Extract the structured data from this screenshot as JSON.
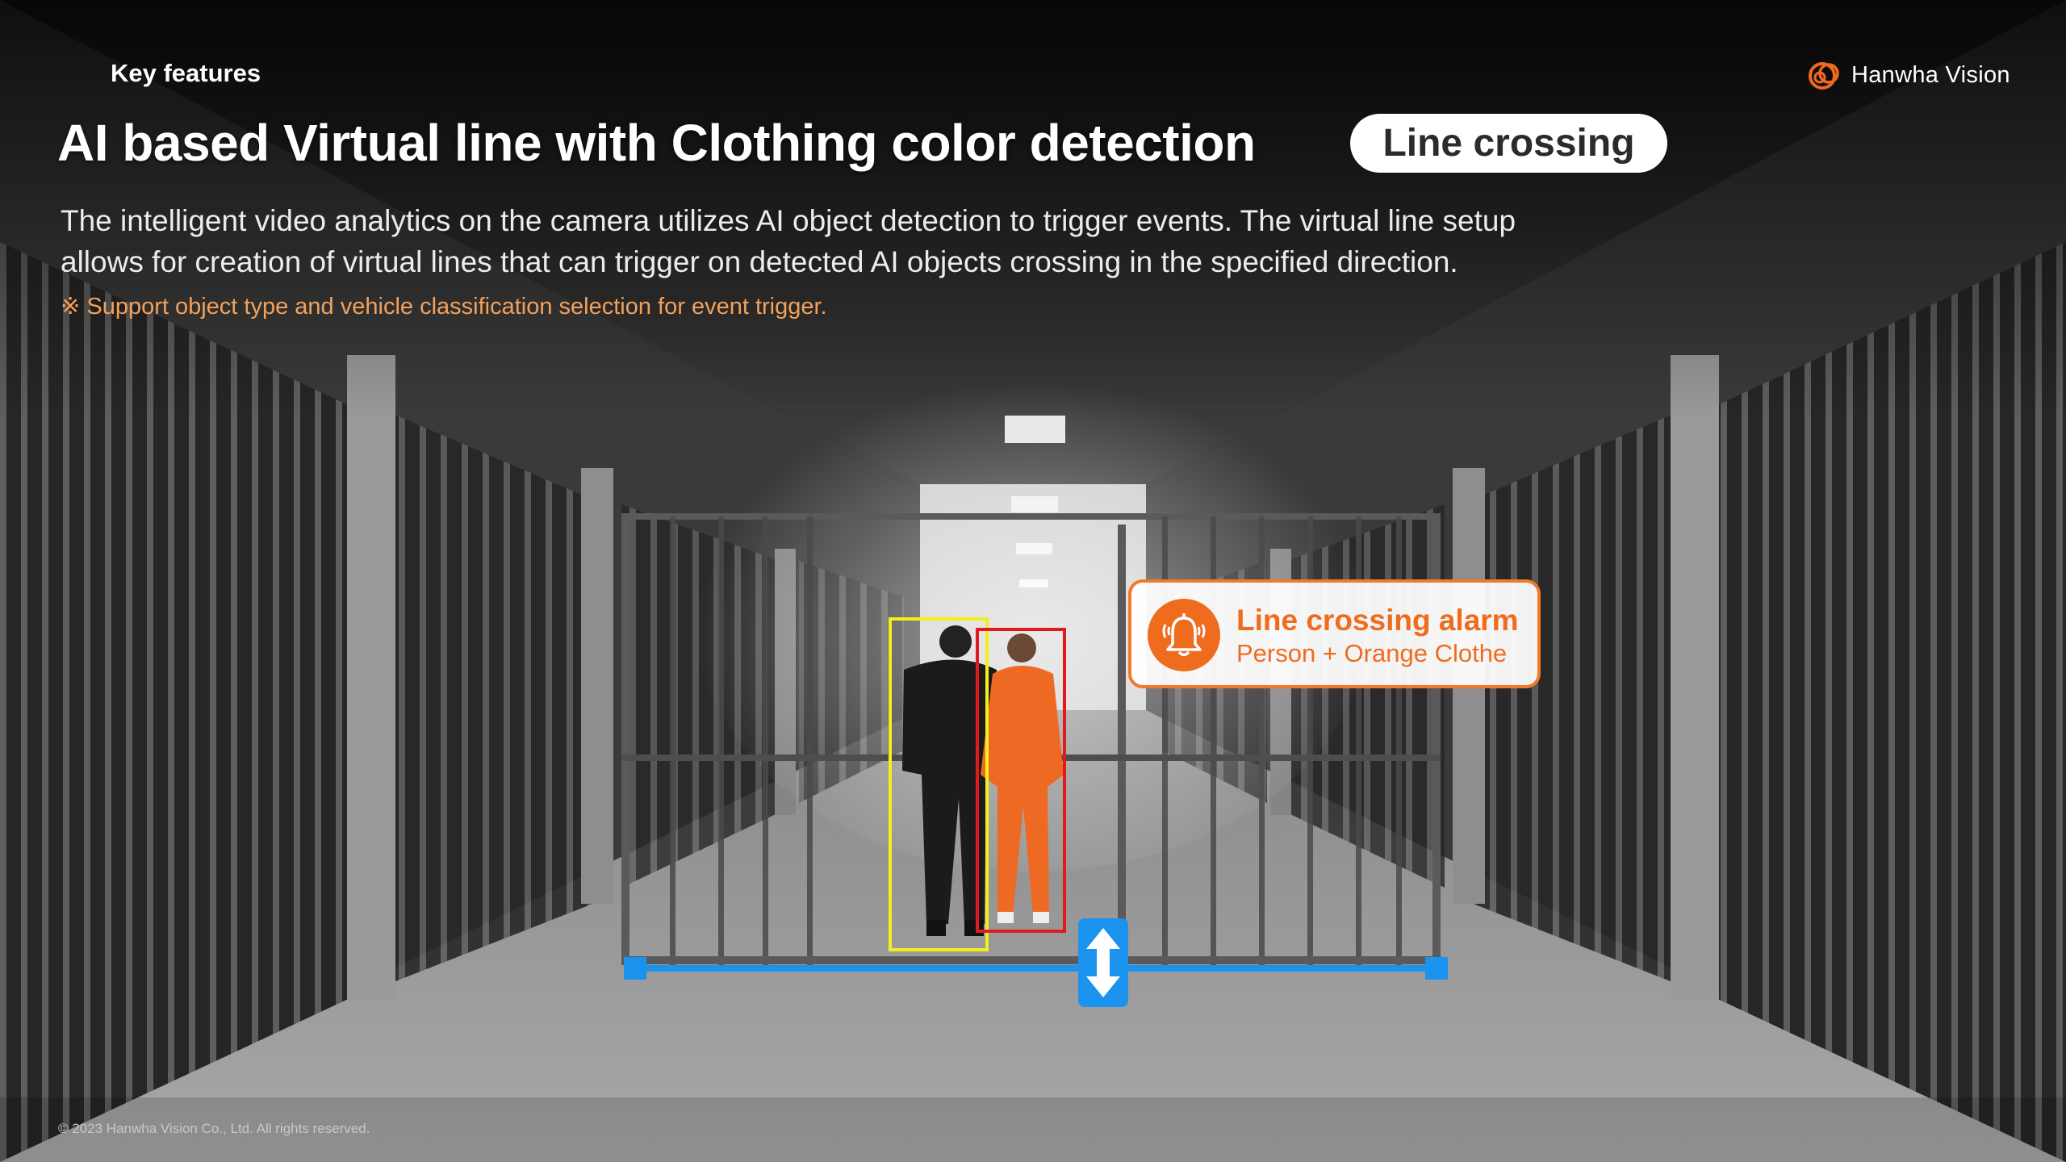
{
  "slide": {
    "kicker": "Key features",
    "title": "AI based Virtual line with Clothing color detection",
    "badge": "Line crossing",
    "description_line1": "The intelligent video analytics on the camera utilizes AI object detection to trigger events. The virtual line setup",
    "description_line2": "allows for creation of virtual lines that can trigger on detected AI objects crossing in the specified direction.",
    "note": "※ Support object type and vehicle classification selection for event trigger.",
    "copyright": "© 2023 Hanwha Vision Co., Ltd. All rights reserved."
  },
  "logo": {
    "text": "Hanwha Vision",
    "icon": "hanwha-logo-icon"
  },
  "alarm": {
    "title": "Line crossing alarm",
    "subtitle": "Person + Orange Clothe",
    "icon": "bell-alarm-icon"
  },
  "detections": [
    {
      "label": "guard",
      "box_color": "#f2ef1f"
    },
    {
      "label": "person-orange-clothe",
      "box_color": "#e11b1b"
    }
  ],
  "virtual_line": {
    "color": "#1a93ee",
    "direction_icon": "double-arrow-vertical-icon"
  },
  "colors": {
    "accent": "#ef6c1e",
    "note": "#f4a05a",
    "line": "#1a93ee"
  }
}
